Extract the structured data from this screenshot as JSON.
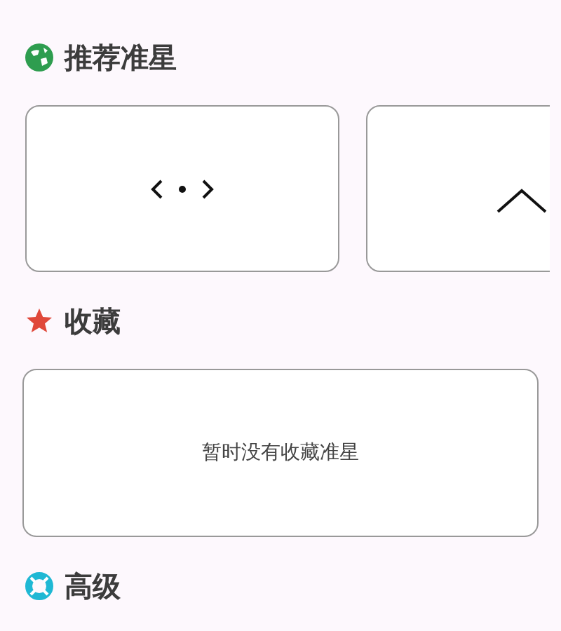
{
  "sections": [
    {
      "kind": "recommended",
      "title": "推荐准星"
    },
    {
      "kind": "favorites",
      "title": "收藏",
      "empty_text": "暂时没有收藏准星"
    },
    {
      "kind": "advanced",
      "title": "高级"
    }
  ]
}
